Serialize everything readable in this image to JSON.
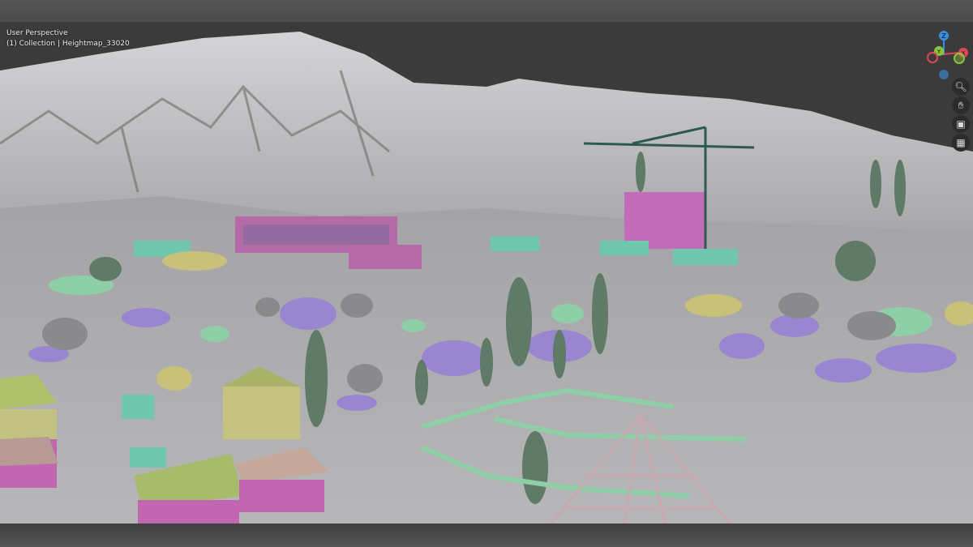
{
  "viewport": {
    "mode": "User Perspective",
    "collection": "(1) Collection | Heightmap_33020"
  },
  "gizmo": {
    "x_label": "X",
    "y_label": "Y",
    "z_label": "Z",
    "colors": {
      "x": "#e0455a",
      "y": "#8ac43a",
      "z": "#3b8de0"
    }
  },
  "nav_icons": [
    "zoom-icon",
    "hand-pan-icon",
    "camera-icon",
    "grid-ortho-icon"
  ],
  "palette": {
    "terrain": "#a9a9ab",
    "purple": "#9a86d0",
    "green": "#8fcfa8",
    "pink": "#c967b5",
    "yellow": "#c9c17a",
    "teal": "#6fc7ad"
  }
}
